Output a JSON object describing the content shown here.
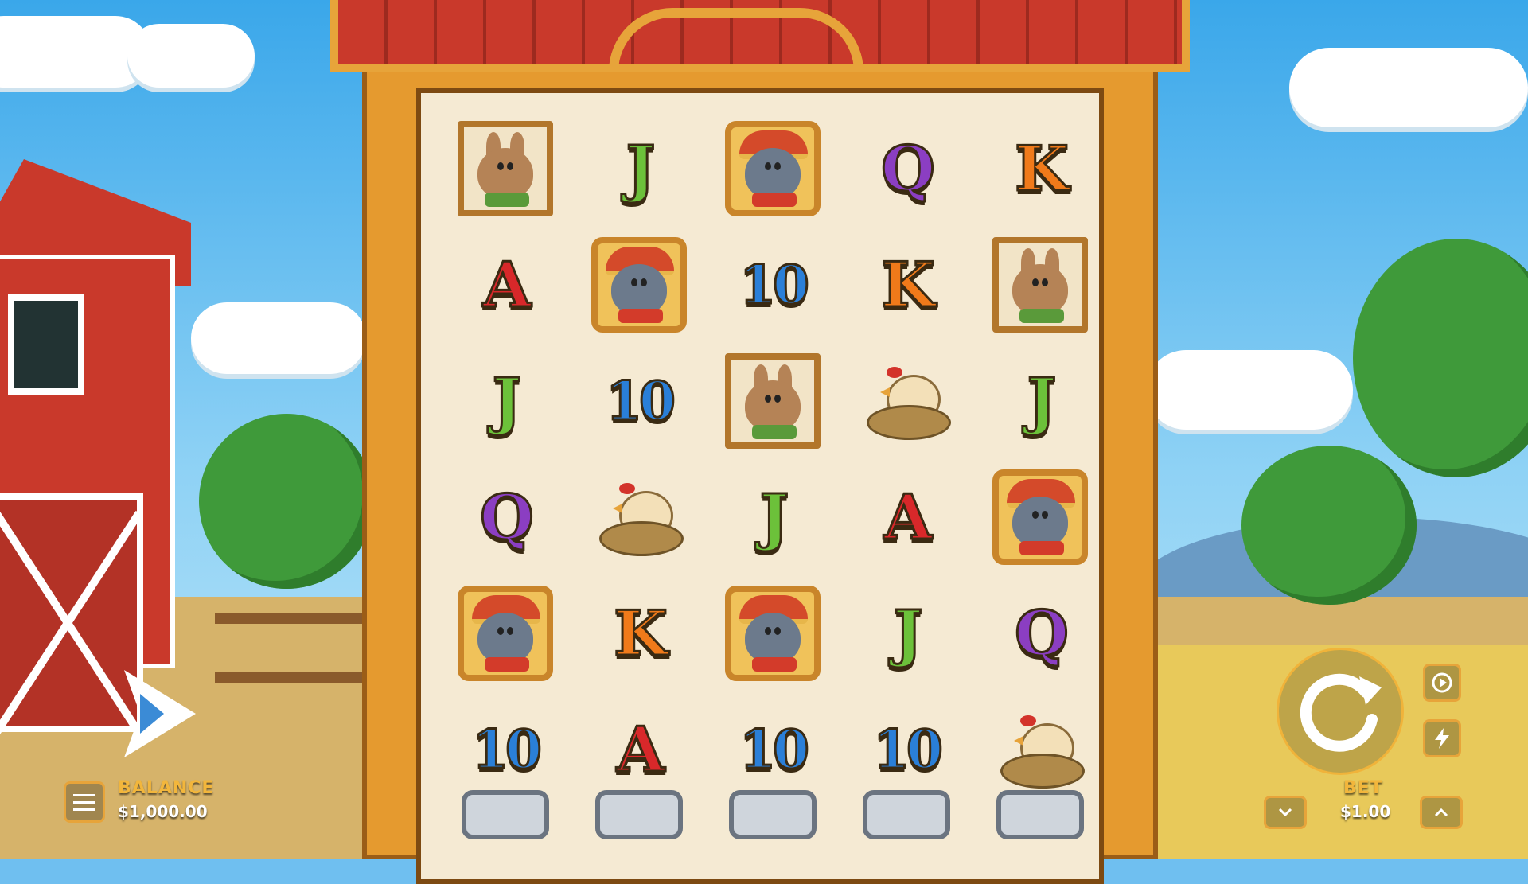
{
  "balance": {
    "label": "BALANCE",
    "value": "$1,000.00"
  },
  "bet": {
    "label": "BET",
    "value": "$1.00"
  },
  "colors": {
    "accent": "#f2b63c",
    "frame": "#e59a2f",
    "roof": "#c9392b"
  },
  "reels": [
    [
      "rabbit",
      "J",
      "wolf",
      "Q",
      "K"
    ],
    [
      "A",
      "wolf",
      "10",
      "K",
      "rabbit"
    ],
    [
      "J",
      "10",
      "rabbit",
      "hen",
      "J"
    ],
    [
      "Q",
      "hen",
      "J",
      "A",
      "wolf"
    ],
    [
      "wolf",
      "K",
      "wolf",
      "J",
      "Q"
    ],
    [
      "10",
      "A",
      "10",
      "10",
      "hen"
    ]
  ],
  "icons": {
    "menu": "hamburger-icon",
    "spin": "spin-arrow-icon",
    "autoplay": "autoplay-icon",
    "turbo": "lightning-icon",
    "bet_down": "chevron-down-icon",
    "bet_up": "chevron-up-icon",
    "logo": "brand-logo"
  }
}
